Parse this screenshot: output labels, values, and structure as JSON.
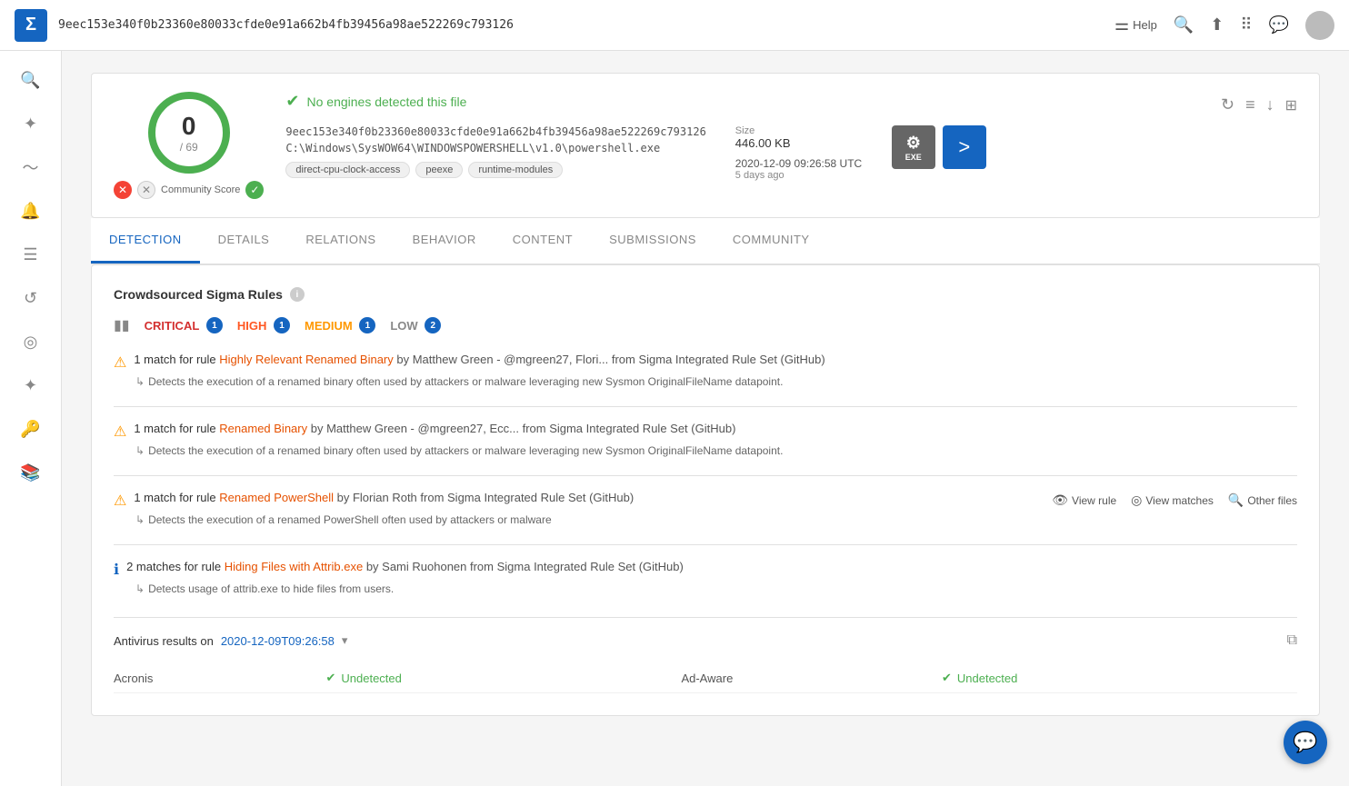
{
  "topbar": {
    "logo": "Σ",
    "hash": "9eec153e340f0b23360e80033cfde0e91a662b4fb39456a98ae522269c793126",
    "help_label": "Help",
    "actions": [
      "filter-icon",
      "search-icon",
      "upload-icon",
      "apps-icon",
      "chat-icon"
    ]
  },
  "sidebar": {
    "items": [
      {
        "name": "search",
        "icon": "🔍"
      },
      {
        "name": "intel",
        "icon": "✦"
      },
      {
        "name": "graph",
        "icon": "〜"
      },
      {
        "name": "alerts",
        "icon": "🔔"
      },
      {
        "name": "list",
        "icon": "☰"
      },
      {
        "name": "history",
        "icon": "↺"
      },
      {
        "name": "toggle",
        "icon": "◎"
      },
      {
        "name": "drone",
        "icon": "✦"
      },
      {
        "name": "key",
        "icon": "🔑"
      },
      {
        "name": "books",
        "icon": "📚"
      }
    ]
  },
  "file_card": {
    "gauge": {
      "score": "0",
      "total": "/ 69"
    },
    "no_engines_text": "No engines detected this file",
    "hash": "9eec153e340f0b23360e80033cfde0e91a662b4fb39456a98ae522269c793126",
    "path": "C:\\Windows\\SysWOW64\\WINDOWSPOWERSHELL\\v1.0\\powershell.exe",
    "tags": [
      "direct-cpu-clock-access",
      "peexe",
      "runtime-modules"
    ],
    "size_label": "Size",
    "size_value": "446.00 KB",
    "date_utc": "2020-12-09 09:26:58 UTC",
    "date_ago": "5 days ago",
    "community_score_label": "Community Score",
    "file_type": "EXE",
    "actions": {
      "refresh": "↻",
      "filter": "≡",
      "download": "↓",
      "share": "⋮"
    }
  },
  "tabs": [
    {
      "label": "DETECTION",
      "active": true
    },
    {
      "label": "DETAILS",
      "active": false
    },
    {
      "label": "RELATIONS",
      "active": false
    },
    {
      "label": "BEHAVIOR",
      "active": false
    },
    {
      "label": "CONTENT",
      "active": false
    },
    {
      "label": "SUBMISSIONS",
      "active": false
    },
    {
      "label": "COMMUNITY",
      "active": false
    }
  ],
  "sigma": {
    "title": "Crowdsourced Sigma Rules",
    "badges": [
      {
        "label": "CRITICAL",
        "count": "1",
        "class": "critical",
        "num": "1"
      },
      {
        "label": "HIGH",
        "count": "1",
        "class": "high",
        "num": "2"
      },
      {
        "label": "MEDIUM",
        "count": "1",
        "class": "medium",
        "num": "3"
      },
      {
        "label": "LOW",
        "count": "2",
        "class": "low",
        "num": "4"
      }
    ],
    "rules": [
      {
        "id": "r1",
        "severity": "warning",
        "count": "1",
        "text_prefix": "1 match for rule ",
        "rule_name": "Highly Relevant Renamed Binary",
        "text_mid": " by Matthew Green - @mgreen27, Flori...  from Sigma Integrated Rule Set (GitHub)",
        "description": "Detects the execution of a renamed binary often used by attackers or malware leveraging new Sysmon OriginalFileName datapoint.",
        "has_actions": false
      },
      {
        "id": "r2",
        "severity": "warning",
        "count": "1",
        "text_prefix": "1 match for rule ",
        "rule_name": "Renamed Binary",
        "text_mid": " by Matthew Green - @mgreen27, Ecc...  from Sigma Integrated Rule Set (GitHub)",
        "description": "Detects the execution of a renamed binary often used by attackers or malware leveraging new Sysmon OriginalFileName datapoint.",
        "has_actions": false
      },
      {
        "id": "r3",
        "severity": "warning",
        "count": "1",
        "text_prefix": "1 match for rule ",
        "rule_name": "Renamed PowerShell",
        "text_mid": " by Florian Roth from Sigma Integrated Rule Set (GitHub)",
        "description": "Detects the execution of a renamed PowerShell often used by attackers or malware",
        "has_actions": true,
        "view_rule": "View rule",
        "view_matches": "View matches",
        "other_files": "Other files"
      },
      {
        "id": "r4",
        "severity": "info",
        "count": "2",
        "text_prefix": "2 matches for rule ",
        "rule_name": "Hiding Files with Attrib.exe",
        "text_mid": " by Sami Ruohonen from Sigma Integrated Rule Set (GitHub)",
        "description": "Detects usage of attrib.exe to hide files from users.",
        "has_actions": false
      }
    ]
  },
  "antivirus": {
    "title_prefix": "Antivirus results on ",
    "date_link": "2020-12-09T09:26:58",
    "rows": [
      {
        "engine": "Acronis",
        "status": "Undetected",
        "engine2": "Ad-Aware",
        "status2": "Undetected"
      }
    ]
  },
  "chat_bubble": "💬"
}
